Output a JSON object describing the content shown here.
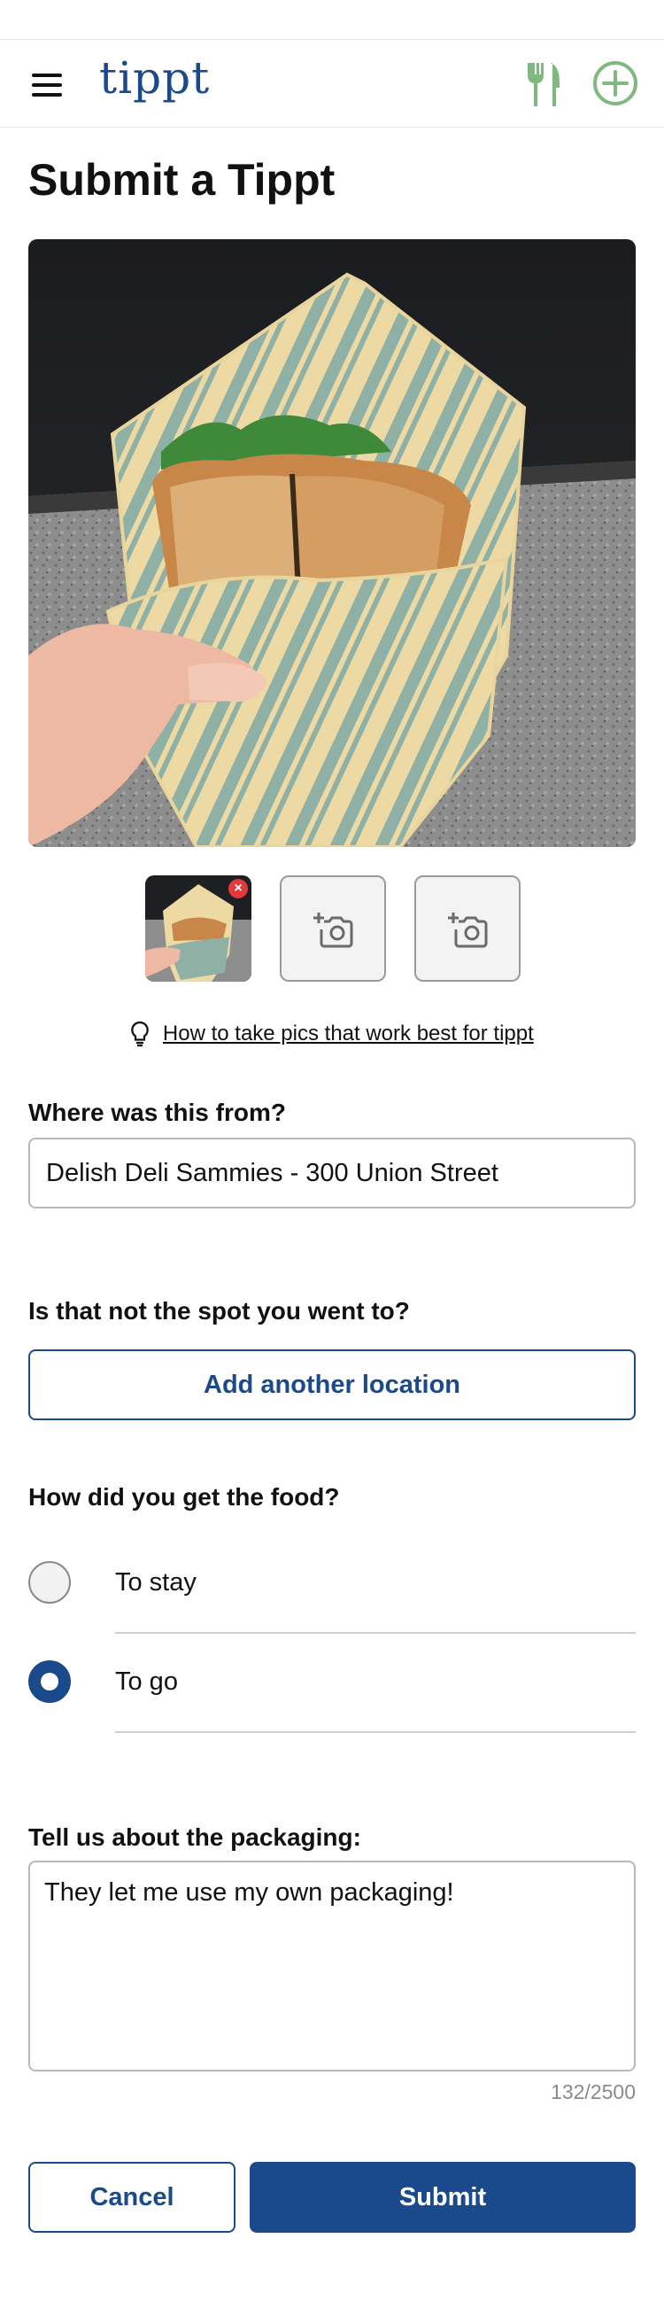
{
  "header": {
    "logo_text": "tippt",
    "menu_icon": "hamburger-menu-icon",
    "fork_icon": "fork-knife-icon",
    "add_icon": "plus-circle-icon",
    "accent": "#1a4a8c",
    "icon_green": "#7fb97f"
  },
  "page": {
    "title": "Submit a Tippt"
  },
  "photos": {
    "main_photo": "sandwich-in-beeswax-wrap-photo",
    "thumbnails": [
      "photo-1",
      "empty",
      "empty"
    ],
    "remove_glyph": "×"
  },
  "tip": {
    "text": "How to take pics that work best for tippt"
  },
  "location": {
    "label": "Where was this from?",
    "value": "Delish Deli Sammies - 300 Union Street"
  },
  "spot": {
    "label": "Is that not the spot you went to?",
    "button": "Add another location"
  },
  "method": {
    "label": "How did you get the food?",
    "options": [
      {
        "label": "To stay",
        "selected": false
      },
      {
        "label": "To go",
        "selected": true
      }
    ]
  },
  "packaging": {
    "label": "Tell us about the packaging:",
    "value": "They let me use my own packaging!",
    "counter": "132/2500"
  },
  "actions": {
    "cancel": "Cancel",
    "submit": "Submit"
  }
}
